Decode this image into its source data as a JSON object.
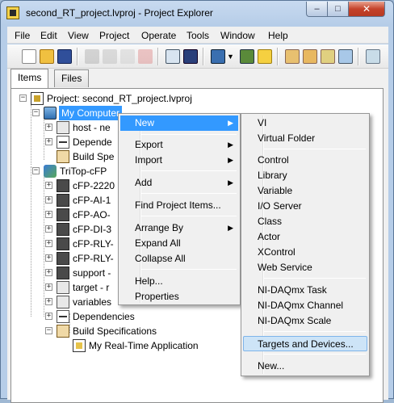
{
  "window": {
    "title": "second_RT_project.lvproj - Project Explorer"
  },
  "menubar": [
    "File",
    "Edit",
    "View",
    "Project",
    "Operate",
    "Tools",
    "Window",
    "Help"
  ],
  "tabs": [
    "Items",
    "Files"
  ],
  "tree": {
    "project": "Project: second_RT_project.lvproj",
    "my_computer": "My Computer",
    "host": "host - ne",
    "dependencies_short": "Depende",
    "build_short": "Build Spe",
    "target": "TriTop-cFP",
    "modules": [
      "cFP-2220",
      "cFP-AI-1",
      "cFP-AO-",
      "cFP-DI-3",
      "cFP-RLY-",
      "cFP-RLY-"
    ],
    "support": "support -",
    "target_item": "target - r",
    "variables": "variables",
    "dependencies": "Dependencies",
    "build_specs": "Build Specifications",
    "rt_app": "My Real-Time Application"
  },
  "context_menu": {
    "items": [
      "New",
      "Export",
      "Import",
      "Add",
      "Find Project Items...",
      "Arrange By",
      "Expand All",
      "Collapse All",
      "Help...",
      "Properties"
    ]
  },
  "submenu": {
    "items": [
      "VI",
      "Virtual Folder",
      "Control",
      "Library",
      "Variable",
      "I/O Server",
      "Class",
      "Actor",
      "XControl",
      "Web Service",
      "NI-DAQmx Task",
      "NI-DAQmx Channel",
      "NI-DAQmx Scale",
      "Targets and Devices...",
      "New..."
    ]
  },
  "icons": {
    "window_minimize": "minimize-icon",
    "window_maximize": "maximize-icon",
    "window_close": "close-icon",
    "submenu_arrow": "chevron-right-icon"
  },
  "glyphs": {
    "minimize": "–",
    "maximize": "□",
    "close": "✕",
    "arrow": "▶",
    "plus": "+",
    "minus": "−"
  }
}
